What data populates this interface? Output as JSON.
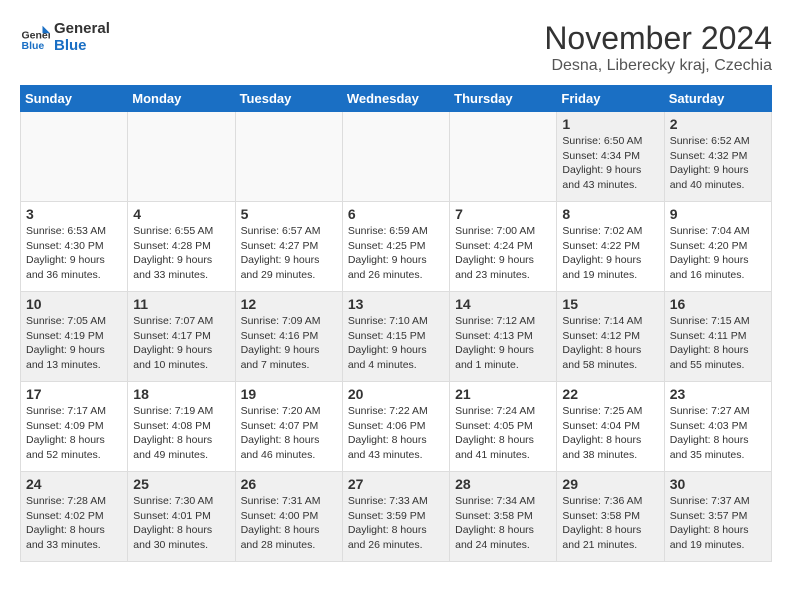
{
  "logo": {
    "line1": "General",
    "line2": "Blue"
  },
  "title": "November 2024",
  "location": "Desna, Liberecky kraj, Czechia",
  "days_of_week": [
    "Sunday",
    "Monday",
    "Tuesday",
    "Wednesday",
    "Thursday",
    "Friday",
    "Saturday"
  ],
  "weeks": [
    [
      {
        "day": "",
        "info": ""
      },
      {
        "day": "",
        "info": ""
      },
      {
        "day": "",
        "info": ""
      },
      {
        "day": "",
        "info": ""
      },
      {
        "day": "",
        "info": ""
      },
      {
        "day": "1",
        "info": "Sunrise: 6:50 AM\nSunset: 4:34 PM\nDaylight: 9 hours\nand 43 minutes."
      },
      {
        "day": "2",
        "info": "Sunrise: 6:52 AM\nSunset: 4:32 PM\nDaylight: 9 hours\nand 40 minutes."
      }
    ],
    [
      {
        "day": "3",
        "info": "Sunrise: 6:53 AM\nSunset: 4:30 PM\nDaylight: 9 hours\nand 36 minutes."
      },
      {
        "day": "4",
        "info": "Sunrise: 6:55 AM\nSunset: 4:28 PM\nDaylight: 9 hours\nand 33 minutes."
      },
      {
        "day": "5",
        "info": "Sunrise: 6:57 AM\nSunset: 4:27 PM\nDaylight: 9 hours\nand 29 minutes."
      },
      {
        "day": "6",
        "info": "Sunrise: 6:59 AM\nSunset: 4:25 PM\nDaylight: 9 hours\nand 26 minutes."
      },
      {
        "day": "7",
        "info": "Sunrise: 7:00 AM\nSunset: 4:24 PM\nDaylight: 9 hours\nand 23 minutes."
      },
      {
        "day": "8",
        "info": "Sunrise: 7:02 AM\nSunset: 4:22 PM\nDaylight: 9 hours\nand 19 minutes."
      },
      {
        "day": "9",
        "info": "Sunrise: 7:04 AM\nSunset: 4:20 PM\nDaylight: 9 hours\nand 16 minutes."
      }
    ],
    [
      {
        "day": "10",
        "info": "Sunrise: 7:05 AM\nSunset: 4:19 PM\nDaylight: 9 hours\nand 13 minutes."
      },
      {
        "day": "11",
        "info": "Sunrise: 7:07 AM\nSunset: 4:17 PM\nDaylight: 9 hours\nand 10 minutes."
      },
      {
        "day": "12",
        "info": "Sunrise: 7:09 AM\nSunset: 4:16 PM\nDaylight: 9 hours\nand 7 minutes."
      },
      {
        "day": "13",
        "info": "Sunrise: 7:10 AM\nSunset: 4:15 PM\nDaylight: 9 hours\nand 4 minutes."
      },
      {
        "day": "14",
        "info": "Sunrise: 7:12 AM\nSunset: 4:13 PM\nDaylight: 9 hours\nand 1 minute."
      },
      {
        "day": "15",
        "info": "Sunrise: 7:14 AM\nSunset: 4:12 PM\nDaylight: 8 hours\nand 58 minutes."
      },
      {
        "day": "16",
        "info": "Sunrise: 7:15 AM\nSunset: 4:11 PM\nDaylight: 8 hours\nand 55 minutes."
      }
    ],
    [
      {
        "day": "17",
        "info": "Sunrise: 7:17 AM\nSunset: 4:09 PM\nDaylight: 8 hours\nand 52 minutes."
      },
      {
        "day": "18",
        "info": "Sunrise: 7:19 AM\nSunset: 4:08 PM\nDaylight: 8 hours\nand 49 minutes."
      },
      {
        "day": "19",
        "info": "Sunrise: 7:20 AM\nSunset: 4:07 PM\nDaylight: 8 hours\nand 46 minutes."
      },
      {
        "day": "20",
        "info": "Sunrise: 7:22 AM\nSunset: 4:06 PM\nDaylight: 8 hours\nand 43 minutes."
      },
      {
        "day": "21",
        "info": "Sunrise: 7:24 AM\nSunset: 4:05 PM\nDaylight: 8 hours\nand 41 minutes."
      },
      {
        "day": "22",
        "info": "Sunrise: 7:25 AM\nSunset: 4:04 PM\nDaylight: 8 hours\nand 38 minutes."
      },
      {
        "day": "23",
        "info": "Sunrise: 7:27 AM\nSunset: 4:03 PM\nDaylight: 8 hours\nand 35 minutes."
      }
    ],
    [
      {
        "day": "24",
        "info": "Sunrise: 7:28 AM\nSunset: 4:02 PM\nDaylight: 8 hours\nand 33 minutes."
      },
      {
        "day": "25",
        "info": "Sunrise: 7:30 AM\nSunset: 4:01 PM\nDaylight: 8 hours\nand 30 minutes."
      },
      {
        "day": "26",
        "info": "Sunrise: 7:31 AM\nSunset: 4:00 PM\nDaylight: 8 hours\nand 28 minutes."
      },
      {
        "day": "27",
        "info": "Sunrise: 7:33 AM\nSunset: 3:59 PM\nDaylight: 8 hours\nand 26 minutes."
      },
      {
        "day": "28",
        "info": "Sunrise: 7:34 AM\nSunset: 3:58 PM\nDaylight: 8 hours\nand 24 minutes."
      },
      {
        "day": "29",
        "info": "Sunrise: 7:36 AM\nSunset: 3:58 PM\nDaylight: 8 hours\nand 21 minutes."
      },
      {
        "day": "30",
        "info": "Sunrise: 7:37 AM\nSunset: 3:57 PM\nDaylight: 8 hours\nand 19 minutes."
      }
    ]
  ]
}
